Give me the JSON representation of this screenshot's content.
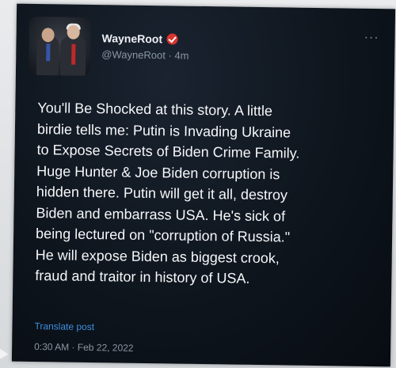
{
  "tweet": {
    "author_name": "WayneRoot",
    "handle": "@WayneRoot",
    "time_ago": "4m",
    "handle_line": "@WayneRoot · 4m",
    "more_menu": "···",
    "text": "You'll Be Shocked at this story. A little\nbirdie tells me: Putin is Invading Ukraine\nto Expose Secrets of Biden Crime Family.\nHuge Hunter & Joe Biden corruption is\nhidden there. Putin will get it all, destroy\nBiden and embarrass USA. He's sick of\nbeing lectured on \"corruption of Russia.\"\nHe will expose Biden as biggest crook,\nfraud and traitor in history of USA.",
    "translate_label": "Translate post",
    "timestamp": "0:30 AM · Feb 22, 2022"
  },
  "colors": {
    "background": "#0e151d",
    "text": "#f4f6f8",
    "muted": "#8a96a3",
    "link": "#3d8fe0",
    "verified_badge": "#d8342e"
  },
  "icons": {
    "verified": "verified-badge-icon",
    "more": "more-options-icon",
    "cursor": "mouse-cursor-icon"
  }
}
